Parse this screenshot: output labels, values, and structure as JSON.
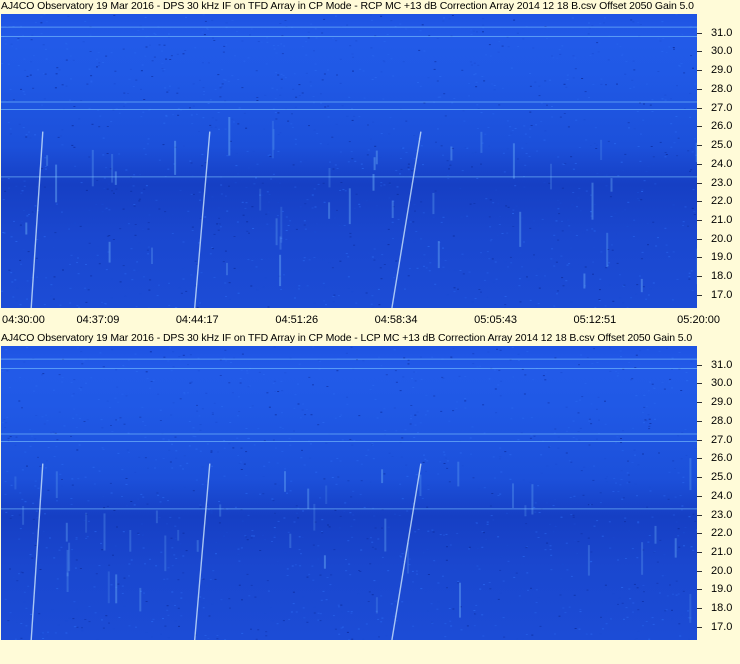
{
  "panels": [
    {
      "title": "AJ4CO Observatory 19 Mar 2016 - DPS 30 kHz IF on TFD Array in CP Mode - RCP  MC +13 dB  Correction Array 2014 12 18 B.csv  Offset 2050  Gain 5.0",
      "polarization": "RCP"
    },
    {
      "title": "AJ4CO Observatory 19 Mar 2016 - DPS 30 kHz IF on TFD Array in CP Mode - LCP  MC +13 dB  Correction Array 2014 12 18 B.csv  Offset 2050  Gain 5.0",
      "polarization": "LCP"
    }
  ],
  "chart_data": [
    {
      "type": "heatmap",
      "title": "AJ4CO Observatory 19 Mar 2016 - DPS 30 kHz IF on TFD Array in CP Mode - RCP  MC +13 dB  Correction Array 2014 12 18 B.csv  Offset 2050  Gain 5.0",
      "x_ticks": [
        "04:30:00",
        "04:37:09",
        "04:44:17",
        "04:51:26",
        "04:58:34",
        "05:05:43",
        "05:12:51",
        "05:20:00"
      ],
      "y_ticks": [
        "31.0",
        "30.0",
        "29.0",
        "28.0",
        "27.0",
        "26.0",
        "25.0",
        "24.0",
        "23.0",
        "22.0",
        "21.0",
        "20.0",
        "19.0",
        "18.0",
        "17.0"
      ],
      "xlim": [
        "04:30:00",
        "05:20:00"
      ],
      "ylim": [
        16.3,
        32.0
      ],
      "colormap": [
        "#0b2a9a",
        "#1a4bd2",
        "#2a68f0",
        "#7fc6ff",
        "#d8f0ff"
      ],
      "sweeps": [
        {
          "t_start": "04:32:10",
          "t_end": "04:33:00"
        },
        {
          "t_start": "04:43:55",
          "t_end": "04:45:00"
        },
        {
          "t_start": "04:58:05",
          "t_end": "05:00:10"
        }
      ],
      "hline_freqs": [
        31.3,
        30.8,
        27.3,
        26.9,
        23.3
      ]
    },
    {
      "type": "heatmap",
      "title": "AJ4CO Observatory 19 Mar 2016 - DPS 30 kHz IF on TFD Array in CP Mode - LCP  MC +13 dB  Correction Array 2014 12 18 B.csv  Offset 2050  Gain 5.0",
      "x_ticks": [],
      "y_ticks": [
        "31.0",
        "30.0",
        "29.0",
        "28.0",
        "27.0",
        "26.0",
        "25.0",
        "24.0",
        "23.0",
        "22.0",
        "21.0",
        "20.0",
        "19.0",
        "18.0",
        "17.0"
      ],
      "xlim": [
        "04:30:00",
        "05:20:00"
      ],
      "ylim": [
        16.3,
        32.0
      ],
      "colormap": [
        "#0b2a9a",
        "#1a4bd2",
        "#2a68f0",
        "#7fc6ff",
        "#d8f0ff"
      ],
      "sweeps": [
        {
          "t_start": "04:32:10",
          "t_end": "04:33:00"
        },
        {
          "t_start": "04:43:55",
          "t_end": "04:45:00"
        },
        {
          "t_start": "04:58:05",
          "t_end": "05:00:10"
        }
      ],
      "hline_freqs": [
        31.3,
        30.8,
        27.3,
        26.9,
        23.3
      ]
    }
  ]
}
